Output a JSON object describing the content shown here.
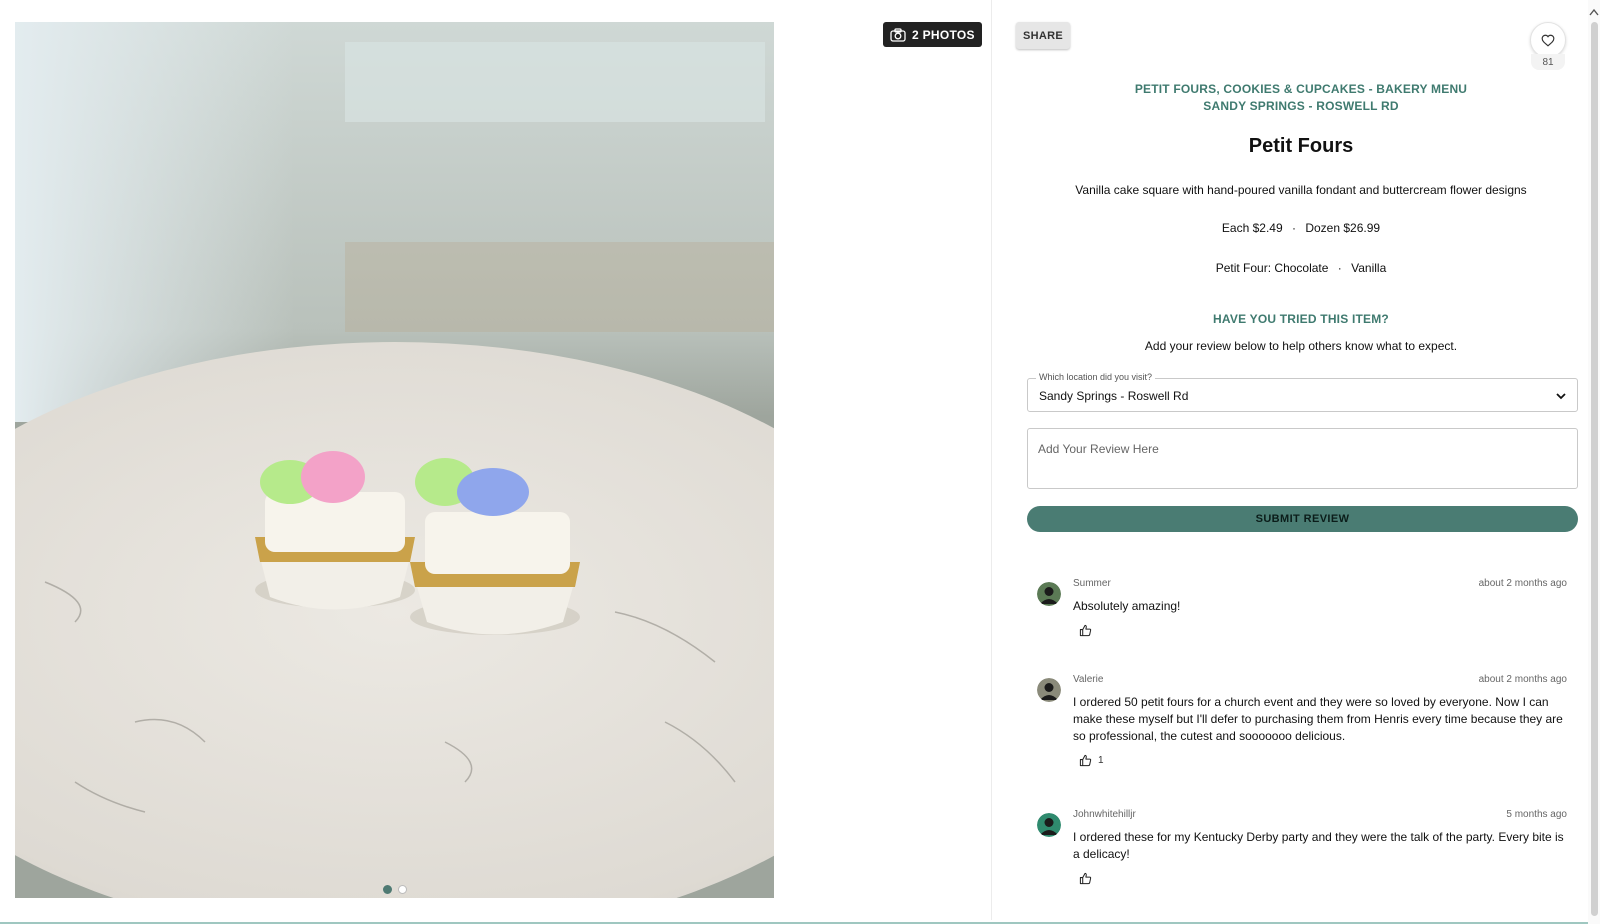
{
  "gallery": {
    "photos_label": "2 PHOTOS",
    "photo_alt": "Two petit fours with green, pink and blue buttercream flowers on a marble table",
    "dot_count": 2,
    "active_dot": 1
  },
  "actions": {
    "share_label": "SHARE",
    "like_count": "81"
  },
  "item": {
    "category": "PETIT FOURS, COOKIES & CUPCAKES - BAKERY MENU",
    "location": "SANDY SPRINGS - ROSWELL RD",
    "title": "Petit Fours",
    "description": "Vanilla cake square with hand-poured vanilla fondant and buttercream flower designs",
    "price_each": "Each $2.49",
    "price_dozen": "Dozen $26.99",
    "flavor_label": "Petit Four:",
    "flavor_1": "Chocolate",
    "flavor_2": "Vanilla",
    "dot": "·"
  },
  "review_form": {
    "heading": "HAVE YOU TRIED THIS ITEM?",
    "subheading": "Add your review below to help others know what to expect.",
    "location_legend": "Which location did you visit?",
    "location_value": "Sandy Springs - Roswell Rd",
    "review_placeholder": "Add Your Review Here",
    "submit_label": "SUBMIT REVIEW"
  },
  "reviews": [
    {
      "name": "Summer",
      "time": "about 2 months ago",
      "text": "Absolutely amazing!",
      "likes": ""
    },
    {
      "name": "Valerie",
      "time": "about 2 months ago",
      "text": "I ordered 50 petit fours for a church event and they were so loved by everyone. Now I can make these myself but I'll defer to purchasing them from Henris every time because they are so professional, the cutest and sooooooo delicious.",
      "likes": "1"
    },
    {
      "name": "Johnwhitehilljr",
      "time": "5 months ago",
      "text": "I ordered these for my Kentucky Derby party and they were the talk of the party. Every bite is a delicacy!",
      "likes": ""
    }
  ],
  "colors": {
    "accent": "#3f7a6f",
    "button": "#4a7c73"
  }
}
